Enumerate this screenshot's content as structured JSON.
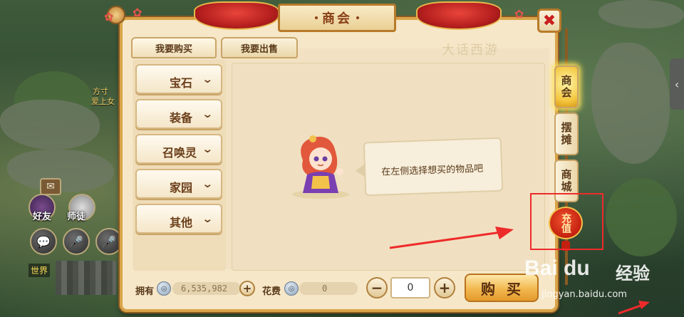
{
  "window": {
    "title": "商会",
    "close_glyph": "✖"
  },
  "top_tabs": [
    {
      "label": "我要购买",
      "active": true
    },
    {
      "label": "我要出售",
      "active": false
    }
  ],
  "watermark": "大话西游",
  "categories": [
    {
      "label": "宝石"
    },
    {
      "label": "装备"
    },
    {
      "label": "召唤灵"
    },
    {
      "label": "家园"
    },
    {
      "label": "其他"
    }
  ],
  "content": {
    "hint": "在左侧选择想买的物品吧"
  },
  "bottom": {
    "own_label": "拥有",
    "own_value": "6,535,982",
    "cost_label": "花费",
    "cost_value": "0",
    "quantity": "0",
    "buy_label": "购买"
  },
  "side_tabs": [
    {
      "label": "商会",
      "active": true
    },
    {
      "label": "摆摊",
      "active": false
    },
    {
      "label": "商城",
      "active": false
    }
  ],
  "recharge_label": "充值",
  "hud": {
    "friends_label": "好友",
    "master_label": "师徒",
    "world_label": "世界",
    "top_text_1": "方寸",
    "top_text_2": "爱上女"
  },
  "overlay": {
    "baidu_logo": "Bai du",
    "baidu_cn": "经验",
    "baidu_url": "jingyan.baidu.com"
  },
  "colors": {
    "panel_bg": "#f6e7c8",
    "panel_border": "#d9a449",
    "accent_red": "#c81e1e",
    "highlight": "#ee2b2b"
  }
}
